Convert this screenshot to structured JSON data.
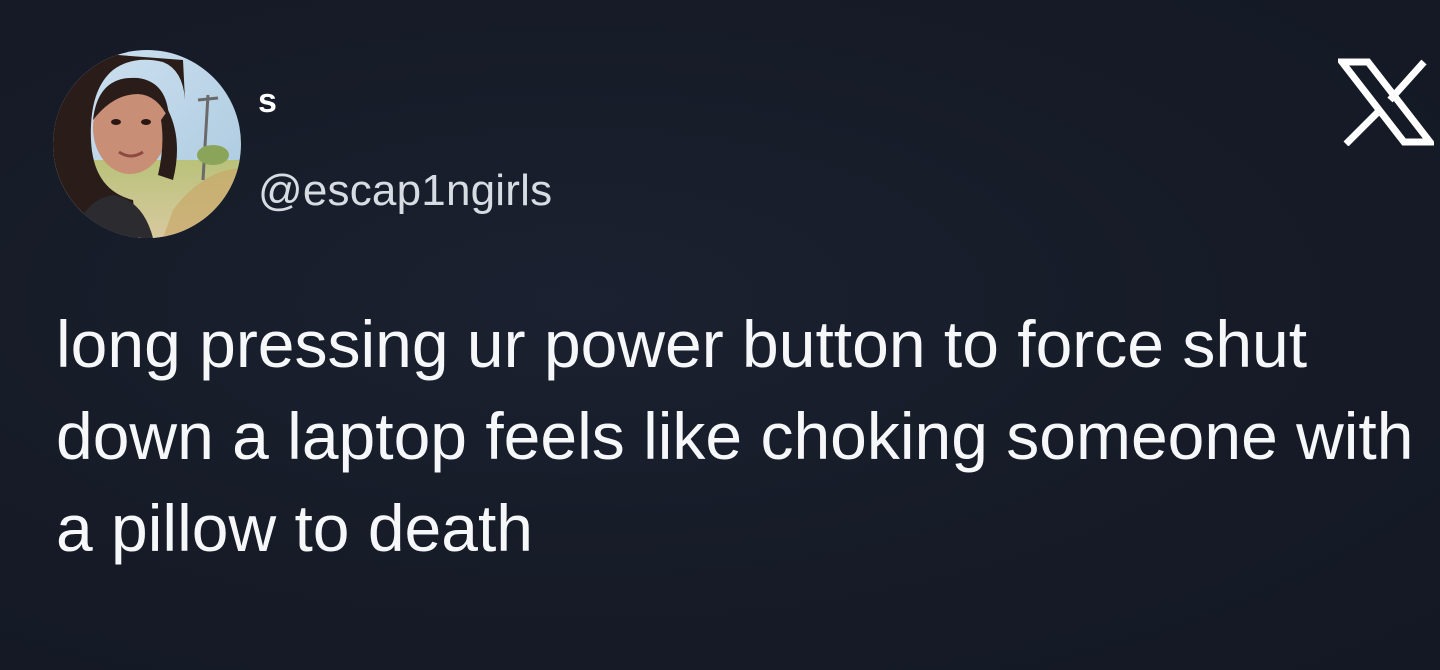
{
  "tweet": {
    "author": {
      "display_name": "s",
      "handle": "@escap1ngirls",
      "avatar_icon": "profile-photo"
    },
    "platform_icon": "x-logo-icon",
    "text": "long pressing ur power button to force shut down a laptop feels like choking someone with a pillow to death"
  },
  "colors": {
    "background": "#151a26",
    "text": "#ffffff",
    "handle": "#d7dbe2"
  }
}
